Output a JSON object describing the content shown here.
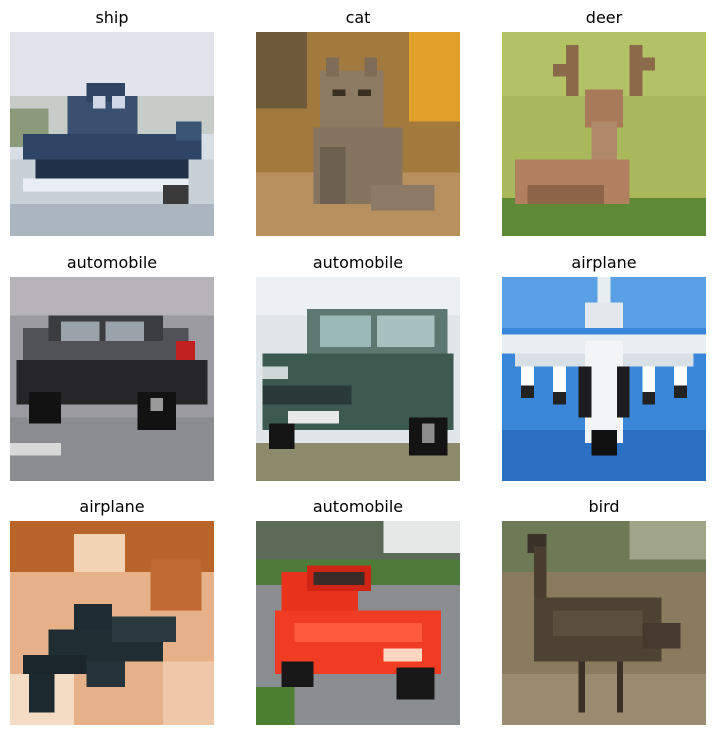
{
  "figure": {
    "panels": [
      {
        "title": "ship",
        "subject": "boat on water"
      },
      {
        "title": "cat",
        "subject": "tabby cat sitting"
      },
      {
        "title": "deer",
        "subject": "deer resting in grass"
      },
      {
        "title": "automobile",
        "subject": "dark hatchback car"
      },
      {
        "title": "automobile",
        "subject": "green minivan"
      },
      {
        "title": "airplane",
        "subject": "fighter jet against blue sky"
      },
      {
        "title": "airplane",
        "subject": "dark jet on orange background"
      },
      {
        "title": "automobile",
        "subject": "red sports car"
      },
      {
        "title": "bird",
        "subject": "emu standing on dirt"
      }
    ]
  }
}
